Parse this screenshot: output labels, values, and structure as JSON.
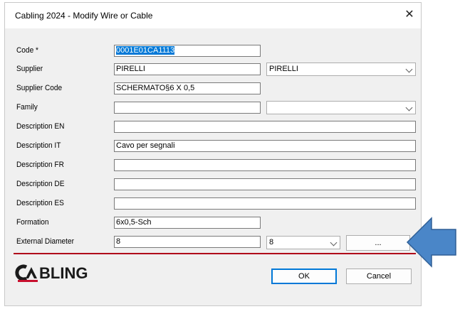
{
  "window": {
    "title": "Cabling 2024 - Modify Wire or Cable",
    "close_glyph": "✕"
  },
  "form": {
    "code": {
      "label": "Code *",
      "value": "0001E01CA1113"
    },
    "supplier": {
      "label": "Supplier",
      "value": "PIRELLI",
      "select": "PIRELLI"
    },
    "supplier_code": {
      "label": "Supplier Code",
      "value": "SCHERMATO§6 X 0,5"
    },
    "family": {
      "label": "Family",
      "value": "",
      "select": ""
    },
    "desc_en": {
      "label": "Description EN",
      "value": ""
    },
    "desc_it": {
      "label": "Description IT",
      "value": "Cavo per segnali"
    },
    "desc_fr": {
      "label": "Description FR",
      "value": ""
    },
    "desc_de": {
      "label": "Description DE",
      "value": ""
    },
    "desc_es": {
      "label": "Description ES",
      "value": ""
    },
    "formation": {
      "label": "Formation",
      "value": "6x0,5-Sch"
    },
    "ext_diameter": {
      "label": "External Diameter",
      "value": "8",
      "select": "8",
      "button": "..."
    }
  },
  "buttons": {
    "ok": "OK",
    "cancel": "Cancel"
  },
  "logo_text": "CABLING",
  "colors": {
    "accent_blue": "#0078d7",
    "logo_red": "#c8102e",
    "arrow": "#4a86c8"
  }
}
